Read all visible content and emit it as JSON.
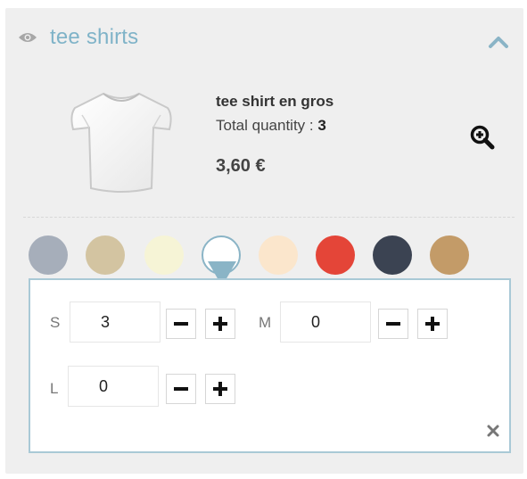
{
  "header": {
    "title": "tee shirts",
    "icons": {
      "visibility": "eye-icon",
      "collapse": "chevron-up-icon"
    }
  },
  "product": {
    "name": "tee shirt en gros",
    "quantity_label": "Total quantity :",
    "quantity_value": "3",
    "price": "3,60 €",
    "zoom_icon": "zoom-in-icon"
  },
  "colors": {
    "swatches": [
      "#a6aeba",
      "#d3c4a1",
      "#f6f4d6",
      "#ffffff",
      "#fbe6cc",
      "#e44538",
      "#3b4352",
      "#c39b68"
    ],
    "selected_index": 3,
    "accent": "#8ab4c6",
    "title_color": "#7fb3c8"
  },
  "sizes": [
    {
      "label": "S",
      "value": "3"
    },
    {
      "label": "M",
      "value": "0"
    },
    {
      "label": "L",
      "value": "0"
    }
  ],
  "close_icon": "close-icon"
}
